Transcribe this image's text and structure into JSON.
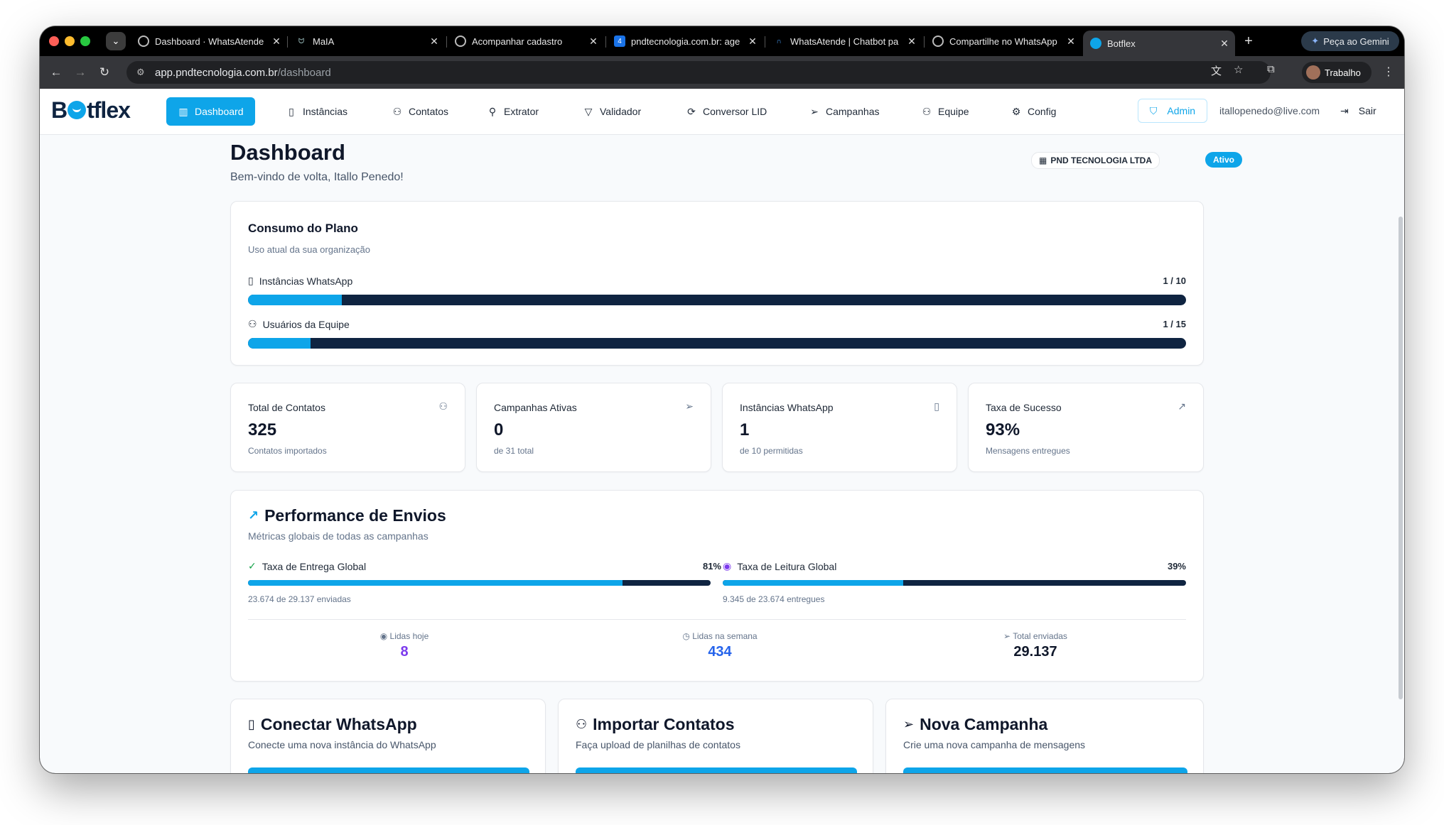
{
  "browser": {
    "tabs": [
      {
        "title": "Dashboard · WhatsAtende",
        "active": false
      },
      {
        "title": "MaIA",
        "active": false
      },
      {
        "title": "Acompanhar cadastro",
        "active": false
      },
      {
        "title": "pndtecnologia.com.br: age",
        "active": false
      },
      {
        "title": "WhatsAtende | Chatbot pa",
        "active": false
      },
      {
        "title": "Compartilhe no WhatsApp",
        "active": false
      },
      {
        "title": "Botflex",
        "active": true
      }
    ],
    "gemini_label": "Peça ao Gemini",
    "url_host": "app.pndtecnologia.com.br",
    "url_path": "/dashboard",
    "profile_label": "Trabalho"
  },
  "app": {
    "logo_left": "B",
    "logo_right": "tflex",
    "nav": [
      {
        "label": "Dashboard",
        "icon": "bar-chart-icon",
        "active": true
      },
      {
        "label": "Instâncias",
        "icon": "smartphone-icon",
        "active": false
      },
      {
        "label": "Contatos",
        "icon": "users-icon",
        "active": false
      },
      {
        "label": "Extrator",
        "icon": "user-search-icon",
        "active": false
      },
      {
        "label": "Validador",
        "icon": "filter-icon",
        "active": false
      },
      {
        "label": "Conversor LID",
        "icon": "refresh-icon",
        "active": false
      },
      {
        "label": "Campanhas",
        "icon": "send-icon",
        "active": false
      },
      {
        "label": "Equipe",
        "icon": "team-icon",
        "active": false
      },
      {
        "label": "Config",
        "icon": "gear-icon",
        "active": false
      }
    ],
    "admin_label": "Admin",
    "user_email": "itallopenedo@live.com",
    "logout_label": "Sair"
  },
  "header": {
    "title": "Dashboard",
    "subtitle": "Bem-vindo de volta, Itallo Penedo!",
    "org_name": "PND TECNOLOGIA LTDA",
    "status": "Ativo"
  },
  "plan": {
    "title": "Consumo do Plano",
    "subtitle": "Uso atual da sua organização",
    "rows": [
      {
        "label": "Instâncias WhatsApp",
        "value": "1 / 10",
        "fraction": 0.1
      },
      {
        "label": "Usuários da Equipe",
        "value": "1 / 15",
        "fraction": 0.0667
      }
    ]
  },
  "stats": [
    {
      "label": "Total de Contatos",
      "value": "325",
      "sub": "Contatos importados",
      "icon": "users-icon"
    },
    {
      "label": "Campanhas Ativas",
      "value": "0",
      "sub": "de 31 total",
      "icon": "send-icon"
    },
    {
      "label": "Instâncias WhatsApp",
      "value": "1",
      "sub": "de 10 permitidas",
      "icon": "smartphone-icon"
    },
    {
      "label": "Taxa de Sucesso",
      "value": "93%",
      "sub": "Mensagens entregues",
      "icon": "trending-up-icon"
    }
  ],
  "performance": {
    "title": "Performance de Envios",
    "subtitle": "Métricas globais de todas as campanhas",
    "delivery": {
      "label": "Taxa de Entrega Global",
      "value": "81%",
      "fraction": 0.81,
      "detail": "23.674 de 29.137 enviadas"
    },
    "read": {
      "label": "Taxa de Leitura Global",
      "value": "39%",
      "fraction": 0.39,
      "detail": "9.345 de 23.674 entregues"
    },
    "kpis": [
      {
        "label": "Lidas hoje",
        "value": "8",
        "color": "#7c3aed"
      },
      {
        "label": "Lidas na semana",
        "value": "434",
        "color": "#2563eb"
      },
      {
        "label": "Total enviadas",
        "value": "29.137",
        "color": "#0f172a"
      }
    ]
  },
  "actions": [
    {
      "title": "Conectar WhatsApp",
      "subtitle": "Conecte uma nova instância do WhatsApp",
      "icon": "smartphone-icon"
    },
    {
      "title": "Importar Contatos",
      "subtitle": "Faça upload de planilhas de contatos",
      "icon": "users-icon"
    },
    {
      "title": "Nova Campanha",
      "subtitle": "Crie uma nova campanha de mensagens",
      "icon": "send-icon"
    }
  ],
  "colors": {
    "accent": "#0ea5e9",
    "bar_track": "#0f2441",
    "delivery_check": "#16a34a",
    "read_eye": "#7c3aed"
  }
}
